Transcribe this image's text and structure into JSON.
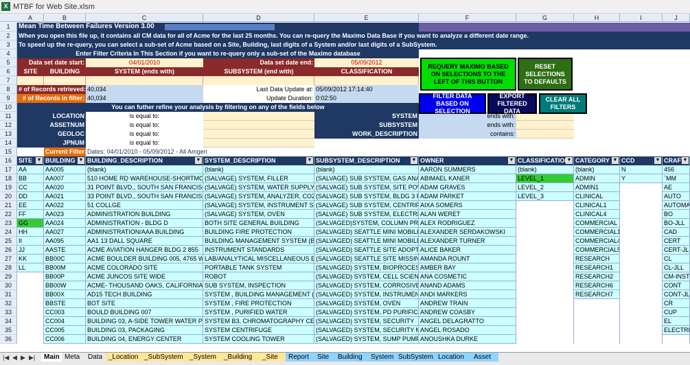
{
  "window": {
    "title": "MTBF for Web Site.xlsm"
  },
  "columns": [
    "A",
    "B",
    "C",
    "D",
    "E",
    "F",
    "G",
    "H",
    "I",
    "J"
  ],
  "rows": [
    "1",
    "2",
    "3",
    "4",
    "5",
    "6",
    "7",
    "8",
    "9",
    "10",
    "11",
    "12",
    "13",
    "14",
    "15",
    "16",
    "17",
    "18",
    "19",
    "20",
    "21",
    "22",
    "23",
    "24",
    "25",
    "26",
    "27",
    "28",
    "29",
    "30",
    "31",
    "32",
    "33",
    "34",
    "35",
    "36"
  ],
  "header": {
    "title": "Mean Time Between Failures Version 3.00",
    "line2": "When you open this file up, it contains all CM data for all of Acme for the last 25 months.  You can re-query the Maximo Data Base if you want to analyze a different date range.",
    "line3": "To speed up the re-query, you can select a sub-set of Acme based on a Site, Building, last digits of a System and/or last digits of a SubSystem.",
    "filter_banner": "Enter Filter Criteria In This Section if you want to re-query only a sub-set of the Maximo database",
    "start_label": "Data set date start:",
    "start_value": "04/01/2010",
    "end_label": "Data set date end:",
    "end_value": "05/09/2012",
    "col_site": "SITE",
    "col_building": "BUILDING",
    "col_system": "SYSTEM (ends with)",
    "col_subsystem": "SUBSYSTEM (end with)",
    "col_classification": "CLASSIFICATION",
    "retrieved_label": "# of Records retrieved:",
    "retrieved_value": "40,034",
    "infilter_label": "# of Records in  filter:",
    "infilter_value": "40,034",
    "last_update_label": "Last Data Update at:",
    "last_update_value": "05/09/2012 17:14:40",
    "update_dur_label": "Update Duration:",
    "update_dur_value": "0:02:50",
    "refine_banner": "You can futher refine your analysis by filtering on any of the fields below",
    "current_filter_label": "Current Filter:",
    "current_filter_value": "Dates: 04/01/2010 - 05/09/2012 - All Amgen"
  },
  "filters_left": [
    {
      "field": "LOCATION",
      "op": "is equal to:"
    },
    {
      "field": "ASSETNUM",
      "op": "is equal to:"
    },
    {
      "field": "GEOLOC",
      "op": "is equal to:"
    },
    {
      "field": "JPNUM",
      "op": "is equal to:"
    }
  ],
  "filters_right": [
    {
      "field": "SYSTEM",
      "op": "ends with:"
    },
    {
      "field": "SUBSYSTEM",
      "op": "ends with:"
    },
    {
      "field": "WORK_DESCRIPTION",
      "op": "contains:"
    }
  ],
  "buttons": {
    "requery": "REQUERY MAXIMO BASED ON SELECTIONS TO THE LEFT OF THIS BUTTON",
    "reset": "RESET SELECTIONS TO DEFAULTS",
    "filter": "FILTER DATA BASED ON SELECTION",
    "export": "EXPORT FILTERED DATA",
    "clear": "CLEAR ALL FILTERS"
  },
  "table_headers": [
    "SITE",
    "BUILDING",
    "BUILDING_DESCRIPTION",
    "SYSTEM_DESCRIPTION",
    "SUBSYSTEM_DESCRIPTION",
    "OWNER",
    "CLASSIFICATION",
    "CATEGORY",
    "CCD",
    "CRAFT"
  ],
  "site": [
    "AA",
    "BB",
    "CC",
    "DD",
    "EE",
    "FF",
    "GG",
    "HH",
    "II",
    "JJ",
    "KK",
    "LL"
  ],
  "building": [
    "AA005",
    "AA007",
    "AA020",
    "AA021",
    "AA022",
    "AA023",
    "AA024",
    "AA027",
    "AA095",
    "AASTE",
    "BB00C",
    "BB00M",
    "BB00P",
    "BB00W",
    "BB00X",
    "BBSTE",
    "CC003",
    "CC004",
    "CC005",
    "CC006"
  ],
  "building_desc": [
    "(blank)",
    "510 HOME RD WAREHOUSE-SHORTMON",
    "31 POINT BLVD., SOUTH SAN FRANCISCO",
    "33 POINT BLVD., SOUTH SAN FRANCISCO",
    "51 COLLGE",
    "ADMINISTRATION BUILDING",
    "ADMINISTRATION - BLDG D",
    "ADMINISTRATION/AAA BUILDING",
    "AA1 13 DALL SQUARE",
    "ACME AVIATION HANGER BLDG 2     855",
    "ACME BOULDER BUILDING 005, 4765 WA",
    "ACME COLORADO SITE",
    "ACME JUNCOS SITE WIDE",
    "ACME- THOUSAND OAKS, CALIFORNIA",
    "AD15 TECH BUILDING",
    "BOT SITE",
    "BOULD BUILDING 007",
    "BUILDING 03, A-SIDE TOWER WATER PU",
    "BUILDING 03, PACKAGING",
    "BUILDING 04, ENERGY CENTER"
  ],
  "system_desc": [
    "(blank)",
    "(SALVAGE) SYSTEM, FILLER",
    "(SALVAGE) SYSTEM, WATER SUPPLY",
    "(SALVAGE) SYSTEM, ANALYZER, CO2",
    "(SALVAGE) SYSTEM, INSTRUMENT STA",
    "(SALVAGE) SYSTEM, OVEN",
    "BOTH SITE GENERAL BUILDING",
    "BUILDING FIRE PROTECTION",
    "BUILDING MANAGEMENT SYSTEM (BMS)",
    "INSTRUMENT STANDARDS",
    "LAB/ANALYTICAL MISCELLANEOUS EQUI",
    "PORTABLE TANK SYSTEM",
    "ROBOT",
    "SUB SYSTEM, INSPECTION",
    "SYSTEM , BUILDING MANAGEMENT (BM",
    "SYSTEM , FIRE PROTECTION",
    "SYSTEM , PURIFIED WATER",
    "SYSTEM B3, CHROMATOGRAPHY CENTR",
    "SYSTEM CENTRIFUGE",
    "SYSTEM COOLING TOWER"
  ],
  "subsystem_desc": [
    "(blank)",
    "(SALVAGE) SUB SYSTEM, GAS ANALY",
    "(SALVAGE) SUB SYSTEM, SITE POW S",
    "(SALVAGE) SUB SYSTEM, BLDG 3 FILLER",
    "(SALVAGE) SUB SYSTEM, CENTRIFUGE, C",
    "(SALVAGE) SUB SYSTEM, ELECTRICAL LIG",
    "(SALVAGED)SYSTEM, COLUMN PRODUC",
    "(SALVAGED) SEATTLE MINI MOBILE",
    "(SALVAGED) SEATTLE MINI MOBILE",
    "(SALVAGED) SEATTLE SITE ADOPT LO",
    "(SALVAGED) SEATTLE SITE MISSING",
    "(SALVAGED) SYSTEM, BIOPROCESSIN",
    "(SALVAGED) SYSTEM, CELL SCIENCES",
    "(SALVAGED) SYSTEM, CORROSIVE W",
    "(SALVAGED) SYSTEM, INSTRUMENT",
    "(SALVAGED) SYSTEM, OVEN",
    "(SALVAGED) SYSTEM, PD PURIFICAT",
    "(SALVAGED) SYSTEM, SECURITY",
    "(SALVAGED) SYSTEM, SECURITY MIS",
    "(SALVAGED) SYSTEM, SUMP PUMP"
  ],
  "owner": [
    "AARON SUMMERS",
    "ABIMAEL KANER",
    "ADAM GRAVES",
    "ADAM PARKET",
    "AIXA SOMERS",
    "ALAN WERET",
    "ALEX RODRIGUEZ",
    "ALEXANDER SERDAKOWSKI",
    "ALEXANDER TURNER",
    "ALICE BAKER",
    "AMANDA ROUNT",
    "AMBER BAY",
    "ANA COSMETIC",
    "ANAND ADAMS",
    "ANDI MARKERS",
    "ANDREW TRAIN",
    "ANDREW COASBY",
    "ANGEL DELAGRATTO",
    "ANGEL ROSADO",
    "ANOUSHKA DURKE"
  ],
  "classification": [
    "(blank)",
    "LEVEL_1",
    "LEVEL_2",
    "LEVEL_3"
  ],
  "category": [
    "(blank)",
    "ADMIN",
    "ADMIN1",
    "CLINICAL",
    "CLINICAL1",
    "CLINICAL4",
    "COMMERCIAL",
    "COMMERCIAL1",
    "COMMERCIAL4",
    "COMMERCIAL5",
    "RESEARCH",
    "RESEARCH1",
    "RESEARCH2",
    "RESEARCH6",
    "RESEARCH7"
  ],
  "ccd": [
    "N",
    "Y"
  ],
  "craft": [
    "456",
    "`MM",
    "AE",
    "AUTO",
    "AUTOMA",
    "BO",
    "BO-JLL",
    "CAD",
    "CERT",
    "CERT-JL",
    "CL",
    "CL-JLL",
    "CM-INST",
    "CONT",
    "CONT-JL",
    "CR",
    "CUP",
    "EL",
    "ELECTRI"
  ],
  "tabs": [
    "Main",
    "Meta",
    "Data",
    "_Location",
    "_SubSystem",
    "_System",
    "_Building",
    "_Site",
    "Report",
    "Site",
    "Building",
    "System",
    "SubSystem",
    "Location",
    "Asset"
  ]
}
